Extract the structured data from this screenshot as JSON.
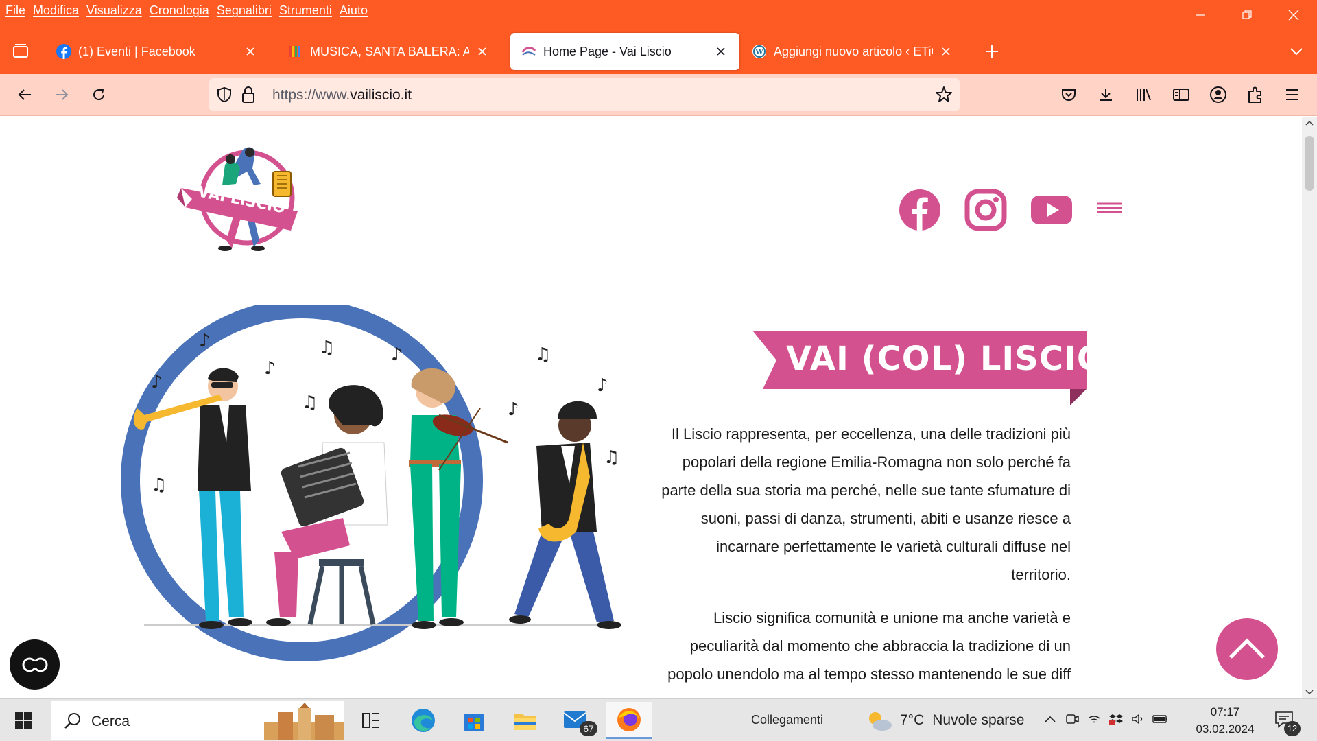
{
  "menubar": {
    "items": [
      "File",
      "Modifica",
      "Visualizza",
      "Cronologia",
      "Segnalibri",
      "Strumenti",
      "Aiuto"
    ]
  },
  "tabs": [
    {
      "title": "(1) Eventi | Facebook",
      "icon": "facebook-icon",
      "active": false
    },
    {
      "title": "MUSICA, SANTA BALERA: AMARC",
      "icon": "google-drive-icon",
      "active": false
    },
    {
      "title": "Home Page - Vai Liscio",
      "icon": "vailiscio-icon",
      "active": true
    },
    {
      "title": "Aggiungi nuovo articolo ‹ ETiCi",
      "icon": "wordpress-icon",
      "active": false
    }
  ],
  "urlbar": {
    "prefix": "https://www.",
    "host": "vailiscio.it"
  },
  "page": {
    "logo_text": "VAI LISCIO",
    "hero_title": "VAI (COL) LISCIO!",
    "paragraph1": "Il Liscio rappresenta, per eccellenza, una delle tradizioni più popolari della regione Emilia-Romagna non solo perché fa parte della sua storia ma perché, nelle sue tante sfumature di suoni, passi di danza, strumenti, abiti e usanze riesce a incarnare perfettamente le varietà culturali diffuse nel territorio.",
    "paragraph2": "Liscio significa comunità e unione ma anche varietà e peculiarità dal momento che abbraccia la tradizione di un popolo unendolo ma al tempo stesso mantenendo le sue diff",
    "social": [
      "facebook-icon",
      "instagram-icon",
      "youtube-icon"
    ],
    "brand_color": "#d4518f",
    "ring_color": "#4a72b8"
  },
  "taskbar": {
    "search_placeholder": "Cerca",
    "mail_badge": "67",
    "collegamenti": "Collegamenti",
    "weather_temp": "7°C",
    "weather_desc": "Nuvole sparse",
    "time": "07:17",
    "date": "03.02.2024",
    "notification_count": "12"
  },
  "colors": {
    "chrome": "#fe5a24",
    "navbar": "#ffd4c6",
    "accent": "#d4518f"
  }
}
